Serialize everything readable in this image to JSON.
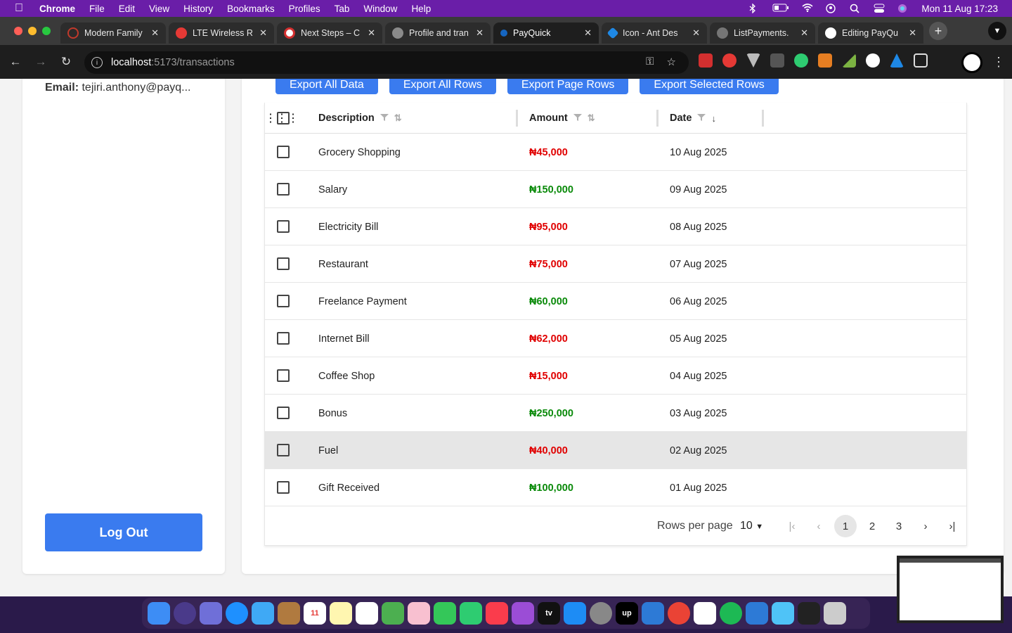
{
  "menubar": {
    "app": "Chrome",
    "items": [
      "File",
      "Edit",
      "View",
      "History",
      "Bookmarks",
      "Profiles",
      "Tab",
      "Window",
      "Help"
    ],
    "datetime": "Mon 11 Aug  17:23"
  },
  "tabs": [
    {
      "title": "Modern Family",
      "color": "#c0392b",
      "active": false
    },
    {
      "title": "LTE Wireless R",
      "color": "#e53935",
      "active": false
    },
    {
      "title": "Next Steps – C",
      "color": "#d32f2f",
      "active": false
    },
    {
      "title": "Profile and tran",
      "color": "#9e9e9e",
      "active": false
    },
    {
      "title": "PayQuick",
      "color": "#1565c0",
      "active": true
    },
    {
      "title": "Icon - Ant Des",
      "color": "#1e88e5",
      "active": false
    },
    {
      "title": "ListPayments.",
      "color": "#757575",
      "active": false
    },
    {
      "title": "Editing PayQu",
      "color": "#ffffff",
      "active": false
    }
  ],
  "address": {
    "host": "localhost",
    "path": ":5173/transactions"
  },
  "sidebar": {
    "email_label": "Email:",
    "email_value": "tejiri.anthony@payq...",
    "logout_label": "Log Out"
  },
  "exports": {
    "all_data": "Export All Data",
    "all_rows": "Export All Rows",
    "page_rows": "Export Page Rows",
    "selected_rows": "Export Selected Rows"
  },
  "table": {
    "headers": {
      "description": "Description",
      "amount": "Amount",
      "date": "Date"
    },
    "rows": [
      {
        "description": "Grocery Shopping",
        "amount": "₦45,000",
        "type": "debit",
        "date": "10 Aug 2025"
      },
      {
        "description": "Salary",
        "amount": "₦150,000",
        "type": "credit",
        "date": "09 Aug 2025"
      },
      {
        "description": "Electricity Bill",
        "amount": "₦95,000",
        "type": "debit",
        "date": "08 Aug 2025"
      },
      {
        "description": "Restaurant",
        "amount": "₦75,000",
        "type": "debit",
        "date": "07 Aug 2025"
      },
      {
        "description": "Freelance Payment",
        "amount": "₦60,000",
        "type": "credit",
        "date": "06 Aug 2025"
      },
      {
        "description": "Internet Bill",
        "amount": "₦62,000",
        "type": "debit",
        "date": "05 Aug 2025"
      },
      {
        "description": "Coffee Shop",
        "amount": "₦15,000",
        "type": "debit",
        "date": "04 Aug 2025"
      },
      {
        "description": "Bonus",
        "amount": "₦250,000",
        "type": "credit",
        "date": "03 Aug 2025"
      },
      {
        "description": "Fuel",
        "amount": "₦40,000",
        "type": "debit",
        "date": "02 Aug 2025",
        "highlighted": true
      },
      {
        "description": "Gift Received",
        "amount": "₦100,000",
        "type": "credit",
        "date": "01 Aug 2025"
      }
    ],
    "pagination": {
      "rows_per_page_label": "Rows per page",
      "rows_per_page": "10",
      "pages": [
        "1",
        "2",
        "3"
      ],
      "current_page": "1"
    }
  },
  "colors": {
    "debit": "#e00000",
    "credit": "#0a8a0a",
    "accent": "#3a7bef"
  }
}
